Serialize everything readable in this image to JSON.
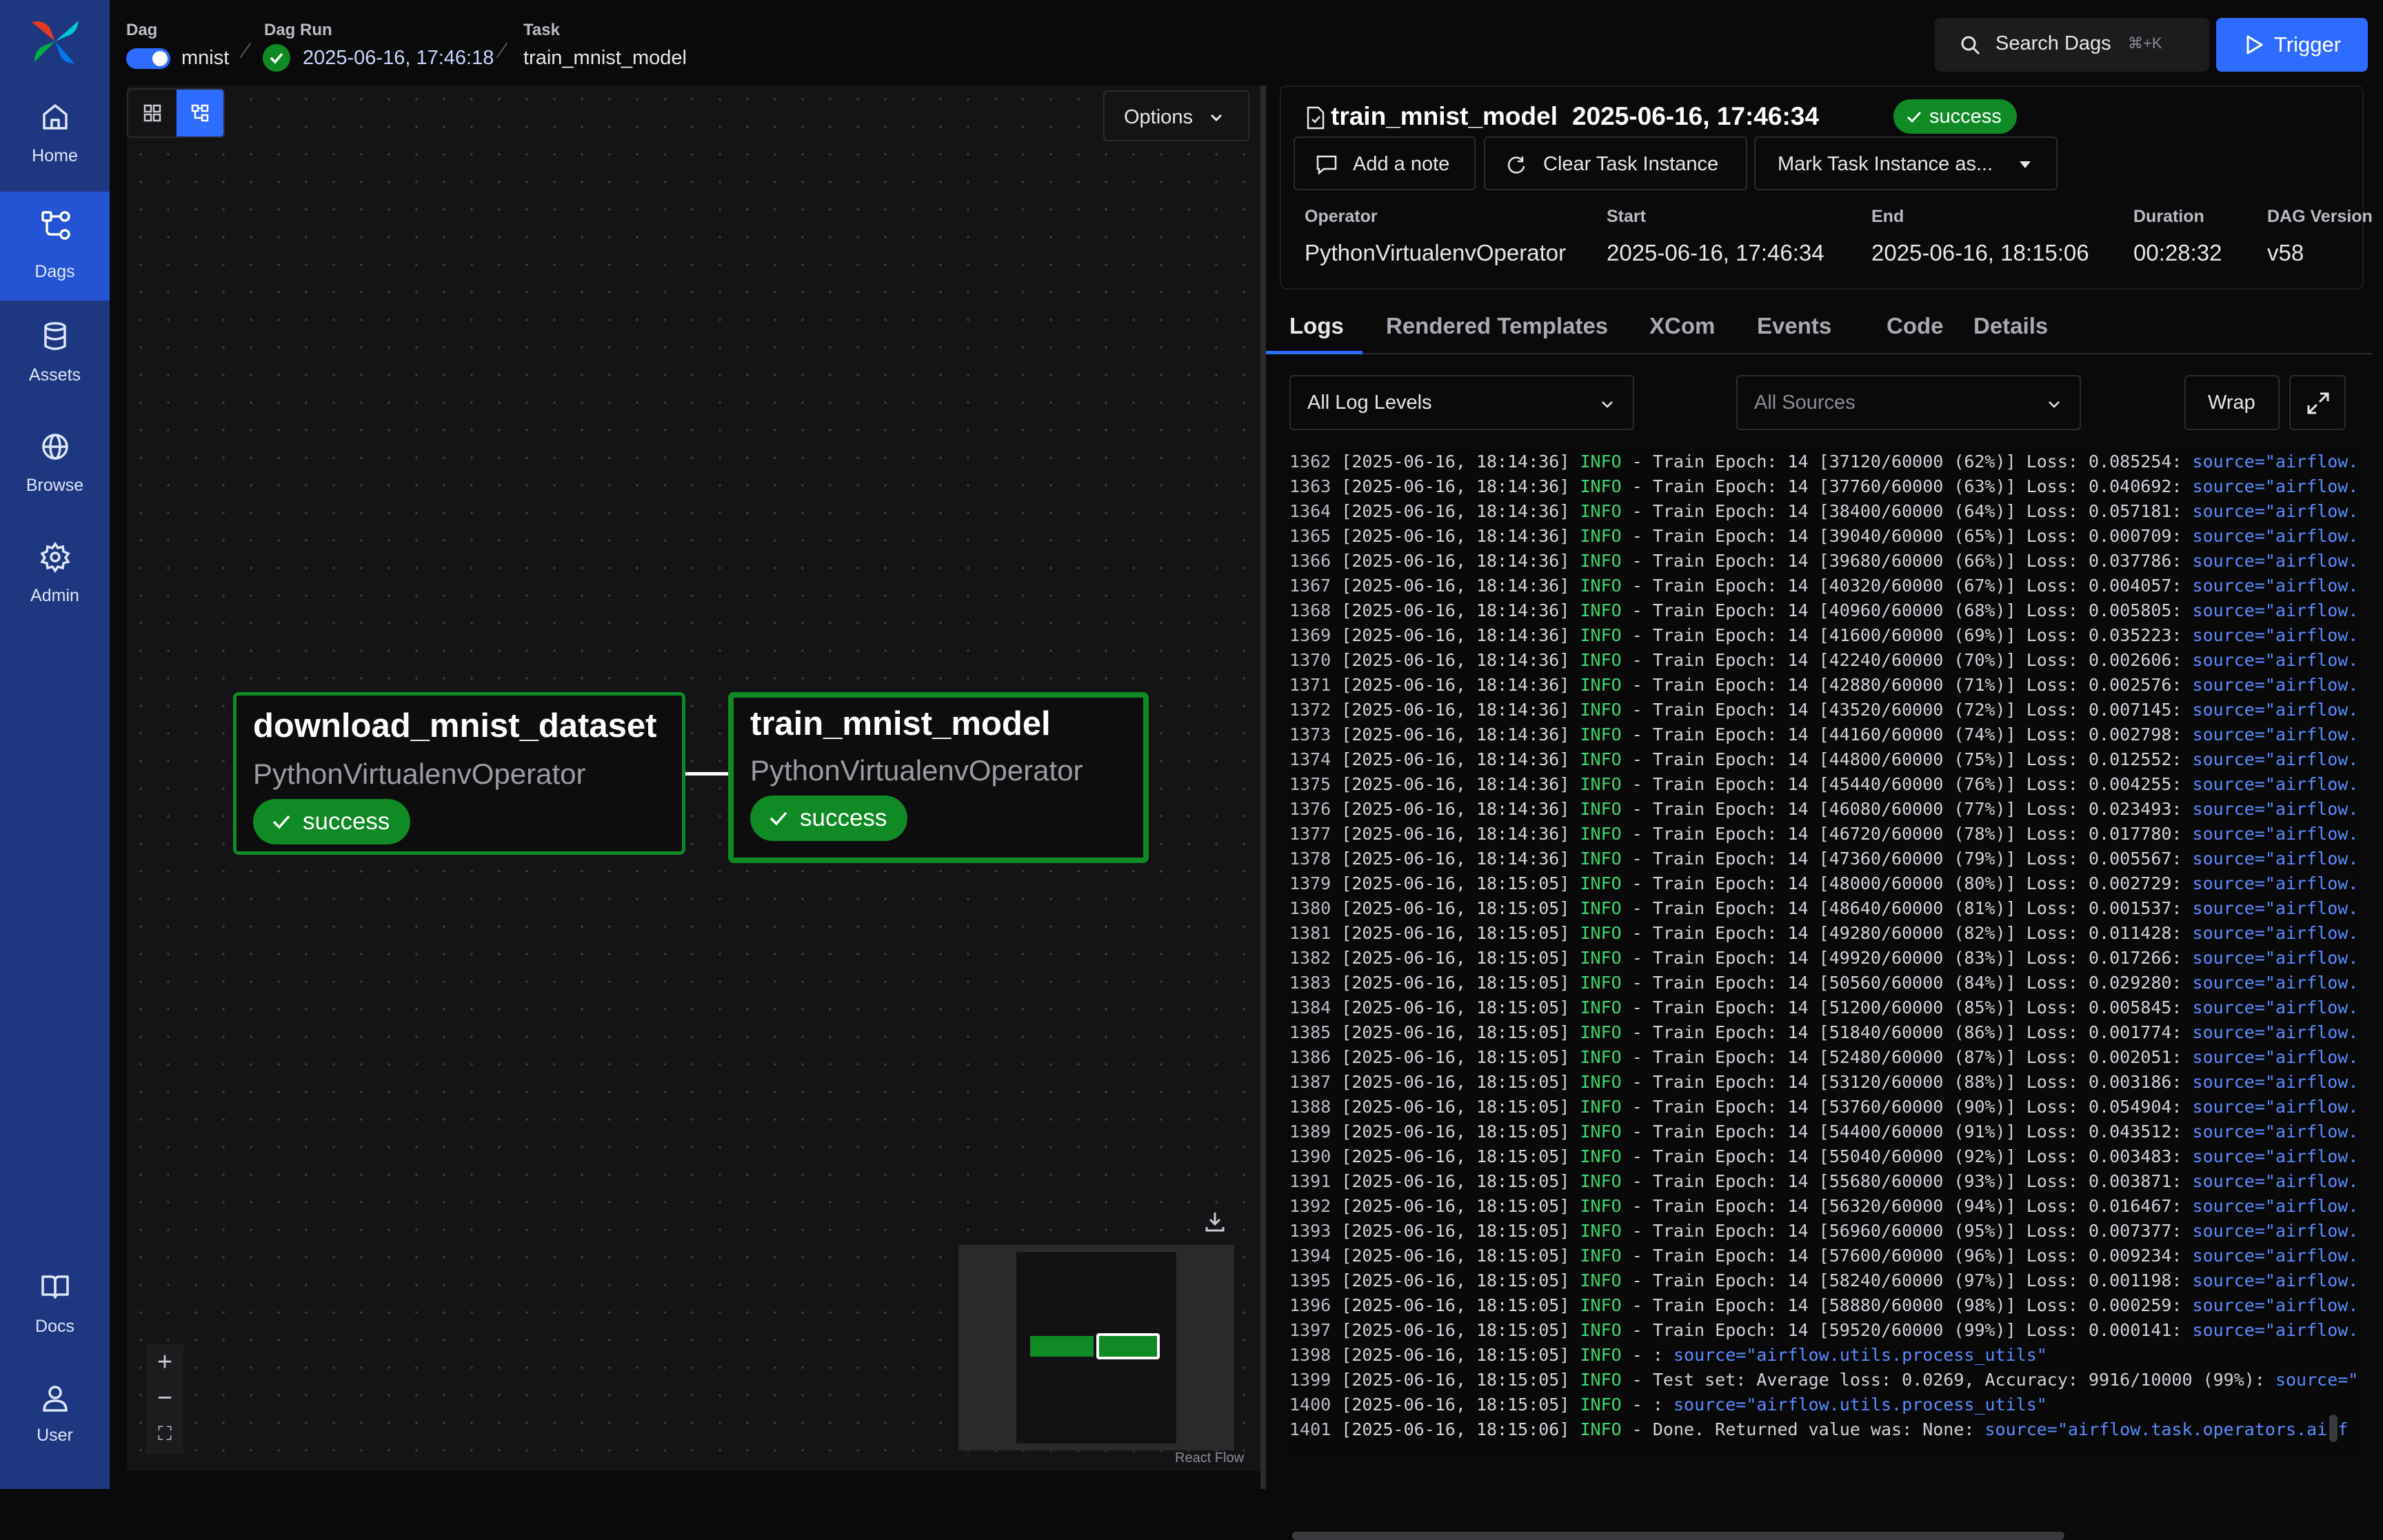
{
  "sidebar": {
    "items": [
      {
        "label": "Home",
        "icon": "home-icon"
      },
      {
        "label": "Dags",
        "icon": "dags-icon"
      },
      {
        "label": "Assets",
        "icon": "database-icon"
      },
      {
        "label": "Browse",
        "icon": "globe-icon"
      },
      {
        "label": "Admin",
        "icon": "gear-icon"
      },
      {
        "label": "Docs",
        "icon": "book-icon"
      },
      {
        "label": "User",
        "icon": "user-icon"
      }
    ]
  },
  "breadcrumb": {
    "dag_title": "Dag",
    "dag_value": "mnist",
    "run_title": "Dag Run",
    "run_value": "2025-06-16, 17:46:18",
    "task_title": "Task",
    "task_value": "train_mnist_model"
  },
  "header_actions": {
    "search_label": "Search Dags",
    "search_shortcut": "⌘+K",
    "trigger_label": "Trigger"
  },
  "graph": {
    "options_label": "Options",
    "attribution": "React Flow",
    "nodes": [
      {
        "name": "download_mnist_dataset",
        "operator": "PythonVirtualenvOperator",
        "state": "success"
      },
      {
        "name": "train_mnist_model",
        "operator": "PythonVirtualenvOperator",
        "state": "success"
      }
    ]
  },
  "task_header": {
    "title": "train_mnist_model",
    "date": "2025-06-16, 17:46:34",
    "state": "success",
    "add_note": "Add a note",
    "clear": "Clear Task Instance",
    "mark": "Mark Task Instance as...",
    "meta": [
      {
        "key": "Operator",
        "value": "PythonVirtualenvOperator"
      },
      {
        "key": "Start",
        "value": "2025-06-16, 17:46:34"
      },
      {
        "key": "End",
        "value": "2025-06-16, 18:15:06"
      },
      {
        "key": "Duration",
        "value": "00:28:32"
      },
      {
        "key": "DAG Version",
        "value": "v58"
      }
    ]
  },
  "tabs": [
    "Logs",
    "Rendered Templates",
    "XCom",
    "Events",
    "Code",
    "Details"
  ],
  "log_controls": {
    "levels": "All Log Levels",
    "sources": "All Sources",
    "wrap": "Wrap"
  },
  "logs": [
    {
      "n": "1362",
      "ts": "[2025-06-16, 18:14:36]",
      "lvl": "INFO",
      "msg": " - Train Epoch: 14 [37120/60000 (62%)] Loss: 0.085254: ",
      "src": "source=\"airflow."
    },
    {
      "n": "1363",
      "ts": "[2025-06-16, 18:14:36]",
      "lvl": "INFO",
      "msg": " - Train Epoch: 14 [37760/60000 (63%)] Loss: 0.040692: ",
      "src": "source=\"airflow."
    },
    {
      "n": "1364",
      "ts": "[2025-06-16, 18:14:36]",
      "lvl": "INFO",
      "msg": " - Train Epoch: 14 [38400/60000 (64%)] Loss: 0.057181: ",
      "src": "source=\"airflow."
    },
    {
      "n": "1365",
      "ts": "[2025-06-16, 18:14:36]",
      "lvl": "INFO",
      "msg": " - Train Epoch: 14 [39040/60000 (65%)] Loss: 0.000709: ",
      "src": "source=\"airflow."
    },
    {
      "n": "1366",
      "ts": "[2025-06-16, 18:14:36]",
      "lvl": "INFO",
      "msg": " - Train Epoch: 14 [39680/60000 (66%)] Loss: 0.037786: ",
      "src": "source=\"airflow."
    },
    {
      "n": "1367",
      "ts": "[2025-06-16, 18:14:36]",
      "lvl": "INFO",
      "msg": " - Train Epoch: 14 [40320/60000 (67%)] Loss: 0.004057: ",
      "src": "source=\"airflow."
    },
    {
      "n": "1368",
      "ts": "[2025-06-16, 18:14:36]",
      "lvl": "INFO",
      "msg": " - Train Epoch: 14 [40960/60000 (68%)] Loss: 0.005805: ",
      "src": "source=\"airflow."
    },
    {
      "n": "1369",
      "ts": "[2025-06-16, 18:14:36]",
      "lvl": "INFO",
      "msg": " - Train Epoch: 14 [41600/60000 (69%)] Loss: 0.035223: ",
      "src": "source=\"airflow."
    },
    {
      "n": "1370",
      "ts": "[2025-06-16, 18:14:36]",
      "lvl": "INFO",
      "msg": " - Train Epoch: 14 [42240/60000 (70%)] Loss: 0.002606: ",
      "src": "source=\"airflow."
    },
    {
      "n": "1371",
      "ts": "[2025-06-16, 18:14:36]",
      "lvl": "INFO",
      "msg": " - Train Epoch: 14 [42880/60000 (71%)] Loss: 0.002576: ",
      "src": "source=\"airflow."
    },
    {
      "n": "1372",
      "ts": "[2025-06-16, 18:14:36]",
      "lvl": "INFO",
      "msg": " - Train Epoch: 14 [43520/60000 (72%)] Loss: 0.007145: ",
      "src": "source=\"airflow."
    },
    {
      "n": "1373",
      "ts": "[2025-06-16, 18:14:36]",
      "lvl": "INFO",
      "msg": " - Train Epoch: 14 [44160/60000 (74%)] Loss: 0.002798: ",
      "src": "source=\"airflow."
    },
    {
      "n": "1374",
      "ts": "[2025-06-16, 18:14:36]",
      "lvl": "INFO",
      "msg": " - Train Epoch: 14 [44800/60000 (75%)] Loss: 0.012552: ",
      "src": "source=\"airflow."
    },
    {
      "n": "1375",
      "ts": "[2025-06-16, 18:14:36]",
      "lvl": "INFO",
      "msg": " - Train Epoch: 14 [45440/60000 (76%)] Loss: 0.004255: ",
      "src": "source=\"airflow."
    },
    {
      "n": "1376",
      "ts": "[2025-06-16, 18:14:36]",
      "lvl": "INFO",
      "msg": " - Train Epoch: 14 [46080/60000 (77%)] Loss: 0.023493: ",
      "src": "source=\"airflow."
    },
    {
      "n": "1377",
      "ts": "[2025-06-16, 18:14:36]",
      "lvl": "INFO",
      "msg": " - Train Epoch: 14 [46720/60000 (78%)] Loss: 0.017780: ",
      "src": "source=\"airflow."
    },
    {
      "n": "1378",
      "ts": "[2025-06-16, 18:14:36]",
      "lvl": "INFO",
      "msg": " - Train Epoch: 14 [47360/60000 (79%)] Loss: 0.005567: ",
      "src": "source=\"airflow."
    },
    {
      "n": "1379",
      "ts": "[2025-06-16, 18:15:05]",
      "lvl": "INFO",
      "msg": " - Train Epoch: 14 [48000/60000 (80%)] Loss: 0.002729: ",
      "src": "source=\"airflow."
    },
    {
      "n": "1380",
      "ts": "[2025-06-16, 18:15:05]",
      "lvl": "INFO",
      "msg": " - Train Epoch: 14 [48640/60000 (81%)] Loss: 0.001537: ",
      "src": "source=\"airflow."
    },
    {
      "n": "1381",
      "ts": "[2025-06-16, 18:15:05]",
      "lvl": "INFO",
      "msg": " - Train Epoch: 14 [49280/60000 (82%)] Loss: 0.011428: ",
      "src": "source=\"airflow."
    },
    {
      "n": "1382",
      "ts": "[2025-06-16, 18:15:05]",
      "lvl": "INFO",
      "msg": " - Train Epoch: 14 [49920/60000 (83%)] Loss: 0.017266: ",
      "src": "source=\"airflow."
    },
    {
      "n": "1383",
      "ts": "[2025-06-16, 18:15:05]",
      "lvl": "INFO",
      "msg": " - Train Epoch: 14 [50560/60000 (84%)] Loss: 0.029280: ",
      "src": "source=\"airflow."
    },
    {
      "n": "1384",
      "ts": "[2025-06-16, 18:15:05]",
      "lvl": "INFO",
      "msg": " - Train Epoch: 14 [51200/60000 (85%)] Loss: 0.005845: ",
      "src": "source=\"airflow."
    },
    {
      "n": "1385",
      "ts": "[2025-06-16, 18:15:05]",
      "lvl": "INFO",
      "msg": " - Train Epoch: 14 [51840/60000 (86%)] Loss: 0.001774: ",
      "src": "source=\"airflow."
    },
    {
      "n": "1386",
      "ts": "[2025-06-16, 18:15:05]",
      "lvl": "INFO",
      "msg": " - Train Epoch: 14 [52480/60000 (87%)] Loss: 0.002051: ",
      "src": "source=\"airflow."
    },
    {
      "n": "1387",
      "ts": "[2025-06-16, 18:15:05]",
      "lvl": "INFO",
      "msg": " - Train Epoch: 14 [53120/60000 (88%)] Loss: 0.003186: ",
      "src": "source=\"airflow."
    },
    {
      "n": "1388",
      "ts": "[2025-06-16, 18:15:05]",
      "lvl": "INFO",
      "msg": " - Train Epoch: 14 [53760/60000 (90%)] Loss: 0.054904: ",
      "src": "source=\"airflow."
    },
    {
      "n": "1389",
      "ts": "[2025-06-16, 18:15:05]",
      "lvl": "INFO",
      "msg": " - Train Epoch: 14 [54400/60000 (91%)] Loss: 0.043512: ",
      "src": "source=\"airflow."
    },
    {
      "n": "1390",
      "ts": "[2025-06-16, 18:15:05]",
      "lvl": "INFO",
      "msg": " - Train Epoch: 14 [55040/60000 (92%)] Loss: 0.003483: ",
      "src": "source=\"airflow."
    },
    {
      "n": "1391",
      "ts": "[2025-06-16, 18:15:05]",
      "lvl": "INFO",
      "msg": " - Train Epoch: 14 [55680/60000 (93%)] Loss: 0.003871: ",
      "src": "source=\"airflow."
    },
    {
      "n": "1392",
      "ts": "[2025-06-16, 18:15:05]",
      "lvl": "INFO",
      "msg": " - Train Epoch: 14 [56320/60000 (94%)] Loss: 0.016467: ",
      "src": "source=\"airflow."
    },
    {
      "n": "1393",
      "ts": "[2025-06-16, 18:15:05]",
      "lvl": "INFO",
      "msg": " - Train Epoch: 14 [56960/60000 (95%)] Loss: 0.007377: ",
      "src": "source=\"airflow."
    },
    {
      "n": "1394",
      "ts": "[2025-06-16, 18:15:05]",
      "lvl": "INFO",
      "msg": " - Train Epoch: 14 [57600/60000 (96%)] Loss: 0.009234: ",
      "src": "source=\"airflow."
    },
    {
      "n": "1395",
      "ts": "[2025-06-16, 18:15:05]",
      "lvl": "INFO",
      "msg": " - Train Epoch: 14 [58240/60000 (97%)] Loss: 0.001198: ",
      "src": "source=\"airflow."
    },
    {
      "n": "1396",
      "ts": "[2025-06-16, 18:15:05]",
      "lvl": "INFO",
      "msg": " - Train Epoch: 14 [58880/60000 (98%)] Loss: 0.000259: ",
      "src": "source=\"airflow."
    },
    {
      "n": "1397",
      "ts": "[2025-06-16, 18:15:05]",
      "lvl": "INFO",
      "msg": " - Train Epoch: 14 [59520/60000 (99%)] Loss: 0.000141: ",
      "src": "source=\"airflow."
    },
    {
      "n": "1398",
      "ts": "[2025-06-16, 18:15:05]",
      "lvl": "INFO",
      "msg": " - : ",
      "src": "source=\"airflow.utils.process_utils\""
    },
    {
      "n": "1399",
      "ts": "[2025-06-16, 18:15:05]",
      "lvl": "INFO",
      "msg": " - Test set: Average loss: 0.0269, Accuracy: 9916/10000 (99%): ",
      "src": "source=\""
    },
    {
      "n": "1400",
      "ts": "[2025-06-16, 18:15:05]",
      "lvl": "INFO",
      "msg": " - : ",
      "src": "source=\"airflow.utils.process_utils\""
    },
    {
      "n": "1401",
      "ts": "[2025-06-16, 18:15:06]",
      "lvl": "INFO",
      "msg": " - Done. Returned value was: None: ",
      "src": "source=\"airflow.task.operators.airf"
    }
  ],
  "colors": {
    "accent": "#2e6bff",
    "success": "#0f8a25",
    "sidebar": "#1d3780",
    "log_level": "#3fd668",
    "log_source": "#5a8bff"
  }
}
